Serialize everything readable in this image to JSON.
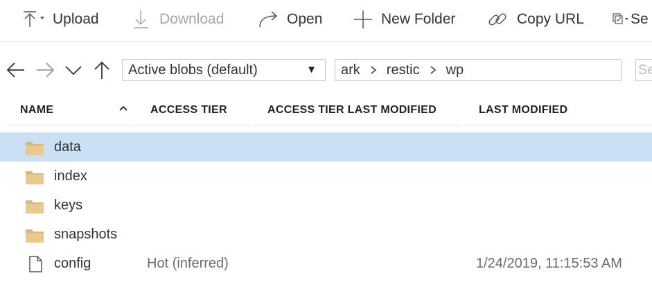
{
  "toolbar": {
    "upload_label": "Upload",
    "download_label": "Download",
    "open_label": "Open",
    "new_folder_label": "New Folder",
    "copy_url_label": "Copy URL",
    "select_label": "Se"
  },
  "nav": {
    "blob_filter": "Active blobs (default)",
    "breadcrumbs": [
      "ark",
      "restic",
      "wp"
    ],
    "search_placeholder": "Se"
  },
  "columns": {
    "name": "NAME",
    "access_tier": "ACCESS TIER",
    "access_tier_last_modified": "ACCESS TIER LAST MODIFIED",
    "last_modified": "LAST MODIFIED"
  },
  "rows": [
    {
      "name": "data",
      "type": "folder",
      "access_tier": "",
      "last_modified": "",
      "selected": true
    },
    {
      "name": "index",
      "type": "folder",
      "access_tier": "",
      "last_modified": ""
    },
    {
      "name": "keys",
      "type": "folder",
      "access_tier": "",
      "last_modified": ""
    },
    {
      "name": "snapshots",
      "type": "folder",
      "access_tier": "",
      "last_modified": ""
    },
    {
      "name": "config",
      "type": "file",
      "access_tier": "Hot (inferred)",
      "last_modified": "1/24/2019, 11:15:53 AM"
    }
  ],
  "colors": {
    "selected_row": "#cce0f5",
    "folder": "#dcb67a",
    "disabled_text": "#a6a6a6"
  }
}
